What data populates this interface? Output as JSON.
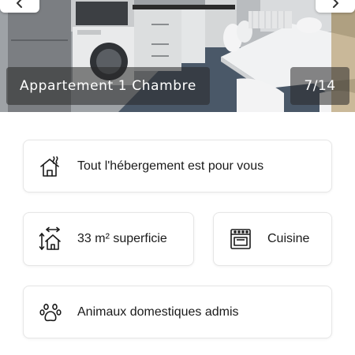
{
  "gallery": {
    "caption": "Appartement 1 Chambre",
    "counter": "7/14",
    "prev_icon": "chevron-left-icon",
    "next_icon": "chevron-right-icon"
  },
  "features": {
    "accommodation": {
      "icon": "house-heating-icon",
      "label": "Tout l'hébergement est pour vous"
    },
    "area": {
      "icon": "area-dimensions-icon",
      "label": "33 m² superficie"
    },
    "kitchen": {
      "icon": "oven-icon",
      "label": "Cuisine"
    },
    "pets": {
      "icon": "paw-icon",
      "label": "Animaux domestiques admis"
    }
  },
  "colors": {
    "card_border": "#e6e6e6",
    "text": "#1a1a1a",
    "caption_overlay": "rgba(40,40,40,0.55)"
  }
}
